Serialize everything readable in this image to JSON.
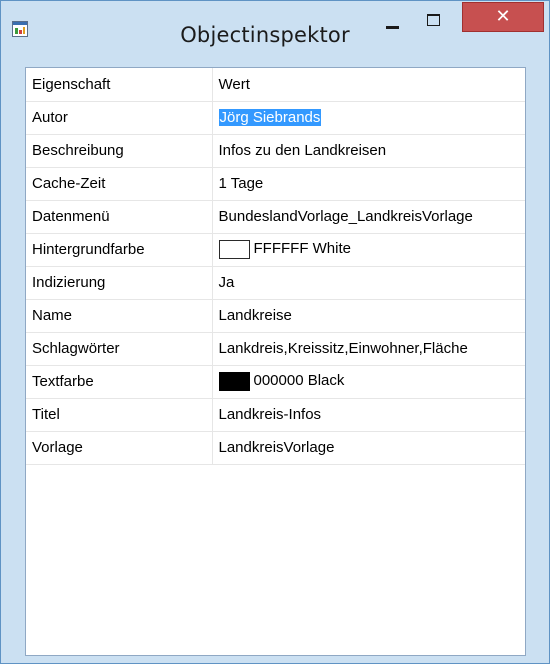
{
  "window": {
    "title": "Objectinspektor",
    "close_label": "✕"
  },
  "colors": {
    "frame": "#cbe0f2",
    "close_button": "#c75050",
    "selection": "#3399ff"
  },
  "grid": {
    "header": {
      "property": "Eigenschaft",
      "value": "Wert"
    },
    "rows": [
      {
        "property": "Autor",
        "value": "Jörg Siebrands",
        "selected": true
      },
      {
        "property": "Beschreibung",
        "value": "Infos zu den Landkreisen"
      },
      {
        "property": "Cache-Zeit",
        "value": "1 Tage"
      },
      {
        "property": "Datenmenü",
        "value": "BundeslandVorlage_LandkreisVorlage"
      },
      {
        "property": "Hintergrundfarbe",
        "value": "FFFFFF White",
        "swatch": "#FFFFFF"
      },
      {
        "property": "Indizierung",
        "value": "Ja"
      },
      {
        "property": "Name",
        "value": "Landkreise"
      },
      {
        "property": "Schlagwörter",
        "value": "Lankdreis,Kreissitz,Einwohner,Fläche"
      },
      {
        "property": "Textfarbe",
        "value": "000000 Black",
        "swatch": "#000000"
      },
      {
        "property": "Titel",
        "value": "Landkreis-Infos"
      },
      {
        "property": "Vorlage",
        "value": "LandkreisVorlage"
      }
    ]
  }
}
